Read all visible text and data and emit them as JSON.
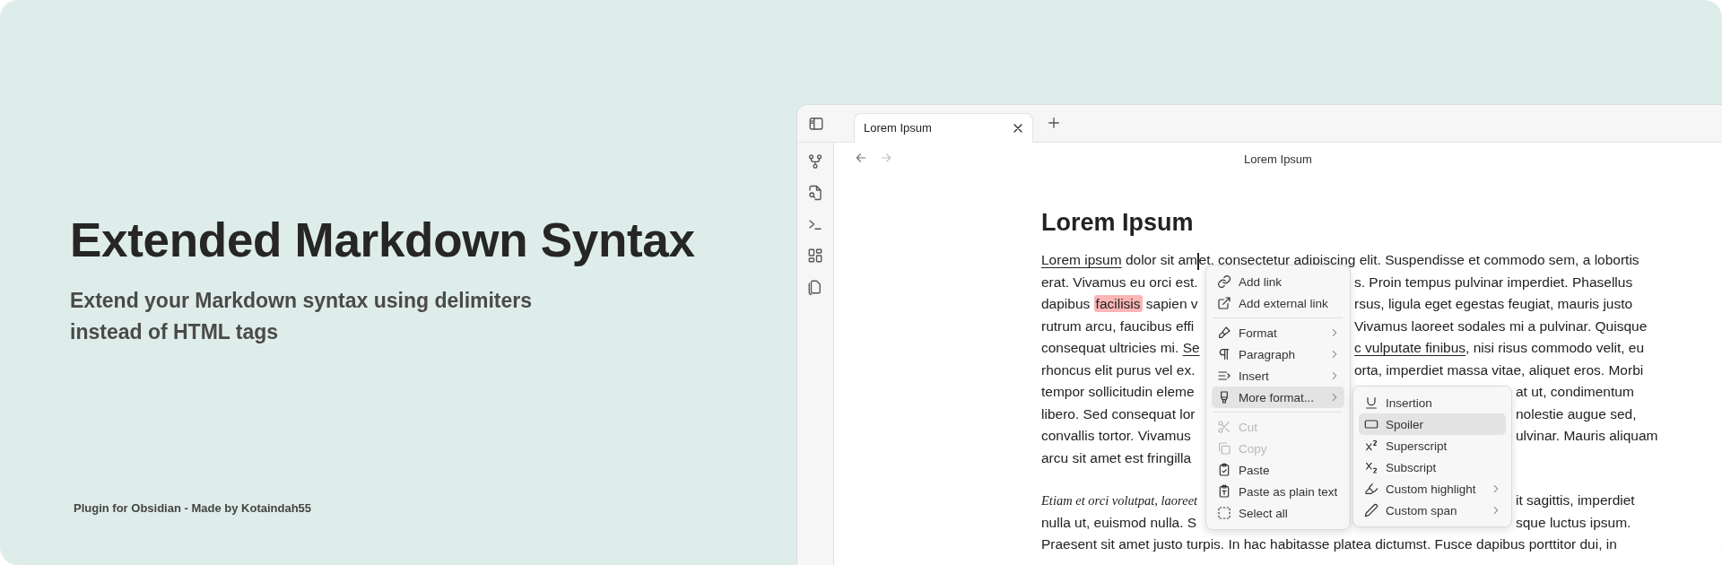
{
  "banner": {
    "title": "Extended Markdown Syntax",
    "subtitle": "Extend your Markdown syntax using delimiters instead of HTML tags",
    "footer": "Plugin for Obsidian - Made by Kotaindah55"
  },
  "window": {
    "tabs": [
      {
        "label": "Lorem Ipsum",
        "selected": true
      }
    ],
    "nav": [
      {
        "disabled": false
      },
      {
        "disabled": true
      }
    ],
    "view_title": "Lorem Ipsum",
    "document": {
      "heading": "Lorem Ipsum",
      "paragraphs": [
        {
          "lines": [
            {
              "parts": [
                [
                  {
                    "kind": "underline",
                    "text": "Lorem ipsum"
                  },
                  {
                    "kind": "plain",
                    "text": " dolor sit am"
                  },
                  {
                    "kind": "cursor"
                  },
                  {
                    "kind": "plain",
                    "text": "et, consectetur adipiscing elit. Suspendisse et commodo sem, a lobortis"
                  }
                ]
              ]
            },
            {
              "parts": [
                [
                  {
                    "kind": "plain",
                    "text": "erat. Vivamus eu orci est."
                  }
                ],
                [
                  {
                    "kind": "plain",
                    "text": "s. Proin tempus pulvinar imperdiet. Phasellus"
                  }
                ]
              ]
            },
            {
              "parts": [
                [
                  {
                    "kind": "plain",
                    "text": "dapibus "
                  },
                  {
                    "kind": "highlight",
                    "text": "facilisis"
                  },
                  {
                    "kind": "plain",
                    "text": " sapien v"
                  }
                ],
                [
                  {
                    "kind": "plain",
                    "text": "rsus, ligula eget egestas feugiat, mauris justo"
                  }
                ]
              ]
            },
            {
              "parts": [
                [
                  {
                    "kind": "plain",
                    "text": "rutrum arcu, faucibus effi"
                  }
                ],
                [
                  {
                    "kind": "plain",
                    "text": " Vivamus laoreet sodales mi a pulvinar. Quisque"
                  }
                ]
              ]
            },
            {
              "parts": [
                [
                  {
                    "kind": "plain",
                    "text": "consequat ultricies mi. "
                  },
                  {
                    "kind": "underline",
                    "text": "Se"
                  }
                ],
                [
                  {
                    "kind": "underline",
                    "text": "c vulputate finibus"
                  },
                  {
                    "kind": "plain",
                    "text": ", nisi risus commodo velit, eu"
                  }
                ]
              ]
            },
            {
              "parts": [
                [
                  {
                    "kind": "plain",
                    "text": "rhoncus elit purus vel ex."
                  }
                ],
                [
                  {
                    "kind": "plain",
                    "text": "orta, imperdiet massa vitae, aliquet eros. Morbi"
                  }
                ]
              ]
            },
            {
              "parts": [
                [
                  {
                    "kind": "plain",
                    "text": "tempor sollicitudin eleme"
                  }
                ],
                [
                  {
                    "kind": "plain",
                    "text": "at ut, condimentum"
                  }
                ]
              ]
            },
            {
              "parts": [
                [
                  {
                    "kind": "plain",
                    "text": "libero. Sed consequat lor"
                  }
                ],
                [
                  {
                    "kind": "plain",
                    "text": "nolestie augue sed,"
                  }
                ]
              ]
            },
            {
              "parts": [
                [
                  {
                    "kind": "plain",
                    "text": "convallis tortor. Vivamus"
                  }
                ],
                [
                  {
                    "kind": "plain",
                    "text": "ulvinar. Mauris aliquam"
                  }
                ]
              ]
            },
            {
              "parts": [
                [
                  {
                    "kind": "plain",
                    "text": "arcu sit amet est fringilla"
                  }
                ]
              ]
            }
          ]
        },
        {
          "lines": [
            {
              "parts": [
                [
                  {
                    "kind": "italic",
                    "text": "Etiam et orci volutpat, laoreet"
                  }
                ],
                [
                  {
                    "kind": "plain",
                    "text": "it sagittis, imperdiet"
                  }
                ]
              ]
            },
            {
              "parts": [
                [
                  {
                    "kind": "plain",
                    "text": "nulla ut, euismod nulla. S"
                  }
                ],
                [
                  {
                    "kind": "plain",
                    "text": "sque luctus ipsum."
                  }
                ]
              ]
            },
            {
              "parts": [
                [
                  {
                    "kind": "plain",
                    "text": "Praesent sit amet justo turpis. In hac habitasse platea dictumst. Fusce dapibus porttitor dui, in"
                  }
                ]
              ]
            }
          ]
        }
      ]
    },
    "context_menu": {
      "items": [
        {
          "kind": "item",
          "label": "Add link",
          "disabled": false,
          "selected": false,
          "has_submenu": false
        },
        {
          "kind": "item",
          "label": "Add external link",
          "disabled": false,
          "selected": false,
          "has_submenu": false
        },
        {
          "kind": "separator"
        },
        {
          "kind": "item",
          "label": "Format",
          "disabled": false,
          "selected": false,
          "has_submenu": true
        },
        {
          "kind": "item",
          "label": "Paragraph",
          "disabled": false,
          "selected": false,
          "has_submenu": true
        },
        {
          "kind": "item",
          "label": "Insert",
          "disabled": false,
          "selected": false,
          "has_submenu": true
        },
        {
          "kind": "item",
          "label": "More format...",
          "disabled": false,
          "selected": true,
          "has_submenu": true
        },
        {
          "kind": "separator"
        },
        {
          "kind": "item",
          "label": "Cut",
          "disabled": true,
          "selected": false,
          "has_submenu": false
        },
        {
          "kind": "item",
          "label": "Copy",
          "disabled": true,
          "selected": false,
          "has_submenu": false
        },
        {
          "kind": "item",
          "label": "Paste",
          "disabled": false,
          "selected": false,
          "has_submenu": false
        },
        {
          "kind": "item",
          "label": "Paste as plain text",
          "disabled": false,
          "selected": false,
          "has_submenu": false
        },
        {
          "kind": "item",
          "label": "Select all",
          "disabled": false,
          "selected": false,
          "has_submenu": false
        }
      ]
    },
    "submenu": {
      "items": [
        {
          "kind": "item",
          "label": "Insertion",
          "disabled": false,
          "selected": false,
          "has_submenu": false
        },
        {
          "kind": "item",
          "label": "Spoiler",
          "disabled": false,
          "selected": true,
          "has_submenu": false
        },
        {
          "kind": "item",
          "label": "Superscript",
          "disabled": false,
          "selected": false,
          "has_submenu": false
        },
        {
          "kind": "item",
          "label": "Subscript",
          "disabled": false,
          "selected": false,
          "has_submenu": false
        },
        {
          "kind": "item",
          "label": "Custom highlight",
          "disabled": false,
          "selected": false,
          "has_submenu": true
        },
        {
          "kind": "item",
          "label": "Custom span",
          "disabled": false,
          "selected": false,
          "has_submenu": true
        }
      ]
    }
  }
}
